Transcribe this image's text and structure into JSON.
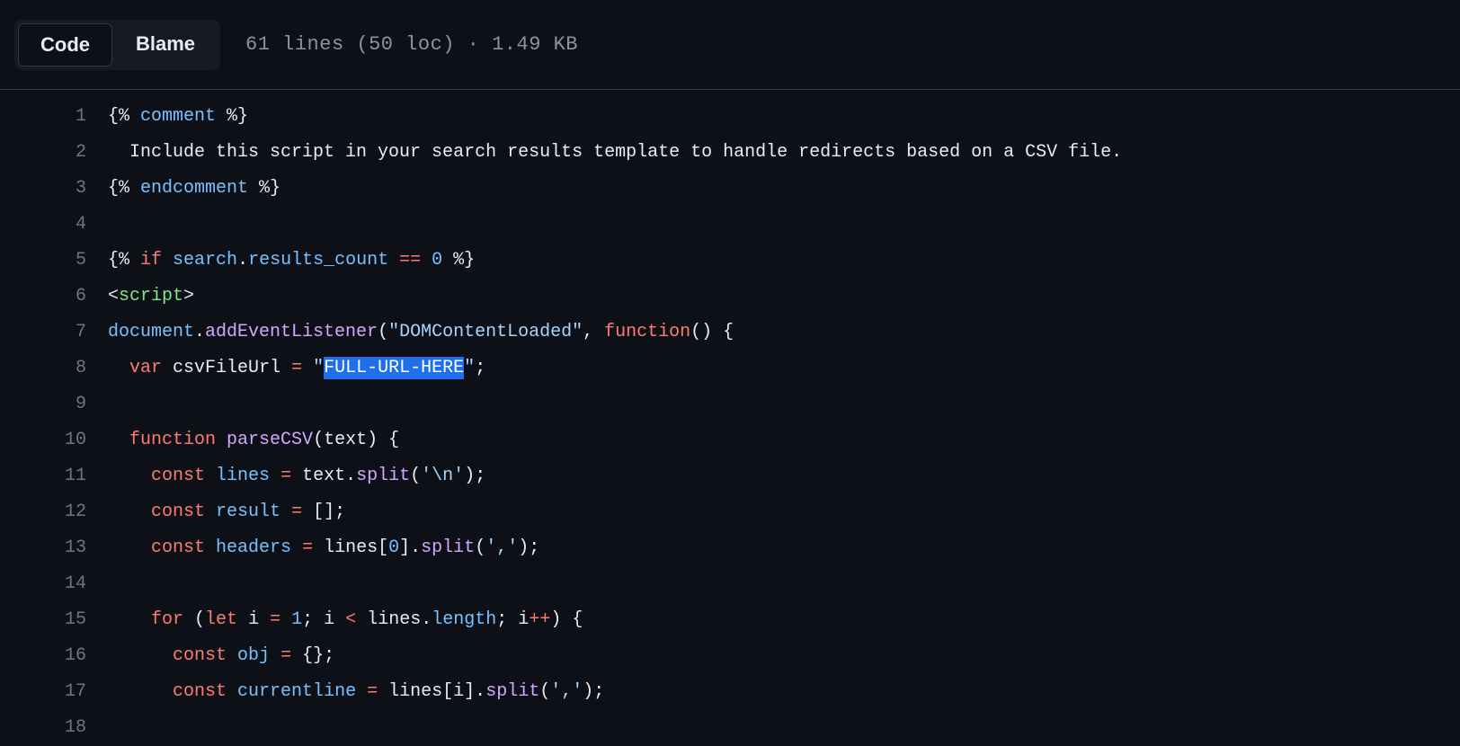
{
  "header": {
    "tabs": {
      "code": "Code",
      "blame": "Blame"
    },
    "file_info": "61 lines (50 loc) · 1.49 KB"
  },
  "code": {
    "lines": [
      {
        "n": 1,
        "tokens": [
          {
            "t": "{% ",
            "c": "tok-default"
          },
          {
            "t": "comment",
            "c": "tok-prop"
          },
          {
            "t": " %}",
            "c": "tok-default"
          }
        ]
      },
      {
        "n": 2,
        "tokens": [
          {
            "t": "  Include this script in your search results template to handle redirects based on a CSV file.",
            "c": "tok-default"
          }
        ]
      },
      {
        "n": 3,
        "tokens": [
          {
            "t": "{% ",
            "c": "tok-default"
          },
          {
            "t": "endcomment",
            "c": "tok-prop"
          },
          {
            "t": " %}",
            "c": "tok-default"
          }
        ]
      },
      {
        "n": 4,
        "tokens": []
      },
      {
        "n": 5,
        "tokens": [
          {
            "t": "{% ",
            "c": "tok-default"
          },
          {
            "t": "if",
            "c": "tok-keyword"
          },
          {
            "t": " ",
            "c": "tok-default"
          },
          {
            "t": "search",
            "c": "tok-prop"
          },
          {
            "t": ".",
            "c": "tok-default"
          },
          {
            "t": "results_count",
            "c": "tok-prop"
          },
          {
            "t": " ",
            "c": "tok-default"
          },
          {
            "t": "==",
            "c": "tok-keyword"
          },
          {
            "t": " ",
            "c": "tok-default"
          },
          {
            "t": "0",
            "c": "tok-num"
          },
          {
            "t": " %}",
            "c": "tok-default"
          }
        ]
      },
      {
        "n": 6,
        "tokens": [
          {
            "t": "<",
            "c": "tok-default"
          },
          {
            "t": "script",
            "c": "tok-tag"
          },
          {
            "t": ">",
            "c": "tok-default"
          }
        ]
      },
      {
        "n": 7,
        "tokens": [
          {
            "t": "document",
            "c": "tok-prop"
          },
          {
            "t": ".",
            "c": "tok-default"
          },
          {
            "t": "addEventListener",
            "c": "tok-func"
          },
          {
            "t": "(",
            "c": "tok-default"
          },
          {
            "t": "\"DOMContentLoaded\"",
            "c": "tok-string"
          },
          {
            "t": ", ",
            "c": "tok-default"
          },
          {
            "t": "function",
            "c": "tok-keyword"
          },
          {
            "t": "() {",
            "c": "tok-default"
          }
        ]
      },
      {
        "n": 8,
        "tokens": [
          {
            "t": "  ",
            "c": "tok-default"
          },
          {
            "t": "var",
            "c": "tok-keyword"
          },
          {
            "t": " ",
            "c": "tok-default"
          },
          {
            "t": "csvFileUrl",
            "c": "tok-var"
          },
          {
            "t": " ",
            "c": "tok-default"
          },
          {
            "t": "=",
            "c": "tok-keyword"
          },
          {
            "t": " ",
            "c": "tok-default"
          },
          {
            "t": "\"",
            "c": "tok-string"
          },
          {
            "t": "FULL-URL-HERE",
            "c": "highlighted"
          },
          {
            "t": "\"",
            "c": "tok-string"
          },
          {
            "t": ";",
            "c": "tok-default"
          }
        ]
      },
      {
        "n": 9,
        "tokens": []
      },
      {
        "n": 10,
        "tokens": [
          {
            "t": "  ",
            "c": "tok-default"
          },
          {
            "t": "function",
            "c": "tok-keyword"
          },
          {
            "t": " ",
            "c": "tok-default"
          },
          {
            "t": "parseCSV",
            "c": "tok-func"
          },
          {
            "t": "(",
            "c": "tok-default"
          },
          {
            "t": "text",
            "c": "tok-var"
          },
          {
            "t": ") {",
            "c": "tok-default"
          }
        ]
      },
      {
        "n": 11,
        "tokens": [
          {
            "t": "    ",
            "c": "tok-default"
          },
          {
            "t": "const",
            "c": "tok-keyword"
          },
          {
            "t": " ",
            "c": "tok-default"
          },
          {
            "t": "lines",
            "c": "tok-prop"
          },
          {
            "t": " ",
            "c": "tok-default"
          },
          {
            "t": "=",
            "c": "tok-keyword"
          },
          {
            "t": " ",
            "c": "tok-default"
          },
          {
            "t": "text",
            "c": "tok-var"
          },
          {
            "t": ".",
            "c": "tok-default"
          },
          {
            "t": "split",
            "c": "tok-func"
          },
          {
            "t": "(",
            "c": "tok-default"
          },
          {
            "t": "'\\n'",
            "c": "tok-string"
          },
          {
            "t": ");",
            "c": "tok-default"
          }
        ]
      },
      {
        "n": 12,
        "tokens": [
          {
            "t": "    ",
            "c": "tok-default"
          },
          {
            "t": "const",
            "c": "tok-keyword"
          },
          {
            "t": " ",
            "c": "tok-default"
          },
          {
            "t": "result",
            "c": "tok-prop"
          },
          {
            "t": " ",
            "c": "tok-default"
          },
          {
            "t": "=",
            "c": "tok-keyword"
          },
          {
            "t": " [];",
            "c": "tok-default"
          }
        ]
      },
      {
        "n": 13,
        "tokens": [
          {
            "t": "    ",
            "c": "tok-default"
          },
          {
            "t": "const",
            "c": "tok-keyword"
          },
          {
            "t": " ",
            "c": "tok-default"
          },
          {
            "t": "headers",
            "c": "tok-prop"
          },
          {
            "t": " ",
            "c": "tok-default"
          },
          {
            "t": "=",
            "c": "tok-keyword"
          },
          {
            "t": " ",
            "c": "tok-default"
          },
          {
            "t": "lines",
            "c": "tok-var"
          },
          {
            "t": "[",
            "c": "tok-default"
          },
          {
            "t": "0",
            "c": "tok-num"
          },
          {
            "t": "].",
            "c": "tok-default"
          },
          {
            "t": "split",
            "c": "tok-func"
          },
          {
            "t": "(",
            "c": "tok-default"
          },
          {
            "t": "','",
            "c": "tok-string"
          },
          {
            "t": ");",
            "c": "tok-default"
          }
        ]
      },
      {
        "n": 14,
        "tokens": []
      },
      {
        "n": 15,
        "tokens": [
          {
            "t": "    ",
            "c": "tok-default"
          },
          {
            "t": "for",
            "c": "tok-keyword"
          },
          {
            "t": " (",
            "c": "tok-default"
          },
          {
            "t": "let",
            "c": "tok-keyword"
          },
          {
            "t": " ",
            "c": "tok-default"
          },
          {
            "t": "i",
            "c": "tok-var"
          },
          {
            "t": " ",
            "c": "tok-default"
          },
          {
            "t": "=",
            "c": "tok-keyword"
          },
          {
            "t": " ",
            "c": "tok-default"
          },
          {
            "t": "1",
            "c": "tok-num"
          },
          {
            "t": "; ",
            "c": "tok-default"
          },
          {
            "t": "i",
            "c": "tok-var"
          },
          {
            "t": " ",
            "c": "tok-default"
          },
          {
            "t": "<",
            "c": "tok-keyword"
          },
          {
            "t": " ",
            "c": "tok-default"
          },
          {
            "t": "lines",
            "c": "tok-var"
          },
          {
            "t": ".",
            "c": "tok-default"
          },
          {
            "t": "length",
            "c": "tok-prop"
          },
          {
            "t": "; ",
            "c": "tok-default"
          },
          {
            "t": "i",
            "c": "tok-var"
          },
          {
            "t": "++",
            "c": "tok-keyword"
          },
          {
            "t": ") {",
            "c": "tok-default"
          }
        ]
      },
      {
        "n": 16,
        "tokens": [
          {
            "t": "      ",
            "c": "tok-default"
          },
          {
            "t": "const",
            "c": "tok-keyword"
          },
          {
            "t": " ",
            "c": "tok-default"
          },
          {
            "t": "obj",
            "c": "tok-prop"
          },
          {
            "t": " ",
            "c": "tok-default"
          },
          {
            "t": "=",
            "c": "tok-keyword"
          },
          {
            "t": " {};",
            "c": "tok-default"
          }
        ]
      },
      {
        "n": 17,
        "tokens": [
          {
            "t": "      ",
            "c": "tok-default"
          },
          {
            "t": "const",
            "c": "tok-keyword"
          },
          {
            "t": " ",
            "c": "tok-default"
          },
          {
            "t": "currentline",
            "c": "tok-prop"
          },
          {
            "t": " ",
            "c": "tok-default"
          },
          {
            "t": "=",
            "c": "tok-keyword"
          },
          {
            "t": " ",
            "c": "tok-default"
          },
          {
            "t": "lines",
            "c": "tok-var"
          },
          {
            "t": "[",
            "c": "tok-default"
          },
          {
            "t": "i",
            "c": "tok-var"
          },
          {
            "t": "].",
            "c": "tok-default"
          },
          {
            "t": "split",
            "c": "tok-func"
          },
          {
            "t": "(",
            "c": "tok-default"
          },
          {
            "t": "','",
            "c": "tok-string"
          },
          {
            "t": ");",
            "c": "tok-default"
          }
        ]
      },
      {
        "n": 18,
        "tokens": []
      }
    ]
  }
}
